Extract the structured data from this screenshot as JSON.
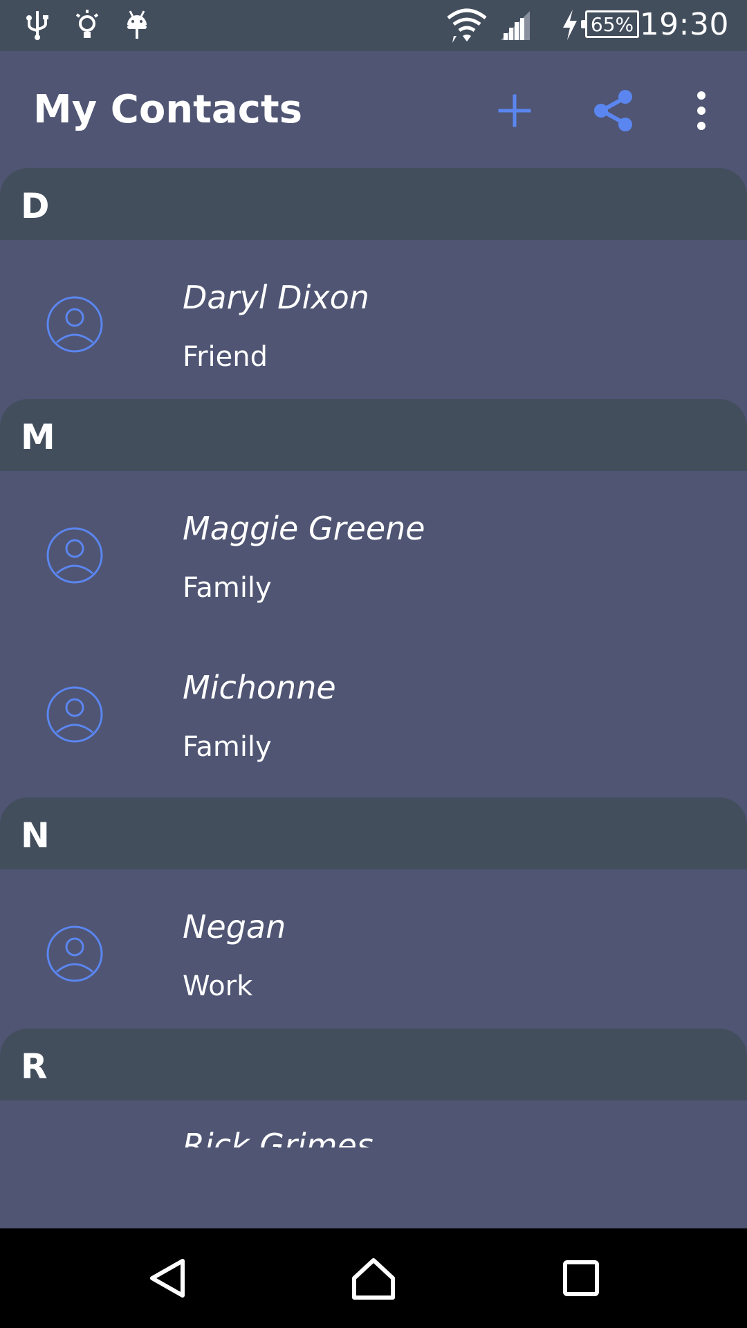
{
  "status_bar": {
    "time": "19:30",
    "battery": "65%",
    "icons": [
      "usb-icon",
      "bulb-icon",
      "android-icon",
      "wifi-icon",
      "signal-icon",
      "charging-icon",
      "battery-icon"
    ]
  },
  "toolbar": {
    "title": "My Contacts",
    "actions": [
      "add-icon",
      "share-icon",
      "overflow-menu-icon"
    ]
  },
  "sections": [
    {
      "letter": "D",
      "contacts": [
        {
          "name": "Daryl Dixon",
          "group": "Friend"
        }
      ]
    },
    {
      "letter": "M",
      "contacts": [
        {
          "name": "Maggie Greene",
          "group": "Family"
        },
        {
          "name": "Michonne",
          "group": "Family"
        }
      ]
    },
    {
      "letter": "N",
      "contacts": [
        {
          "name": "Negan",
          "group": "Work"
        }
      ]
    },
    {
      "letter": "R",
      "contacts": [
        {
          "name": "Rick Grimes",
          "group": ""
        }
      ]
    }
  ],
  "nav": [
    "back-icon",
    "home-icon",
    "recents-icon"
  ],
  "colors": {
    "background": "#4f5573",
    "section_header": "#434e5d",
    "status_bar": "#434e5d",
    "accent": "#5b86f0",
    "nav_bar": "#000000"
  }
}
